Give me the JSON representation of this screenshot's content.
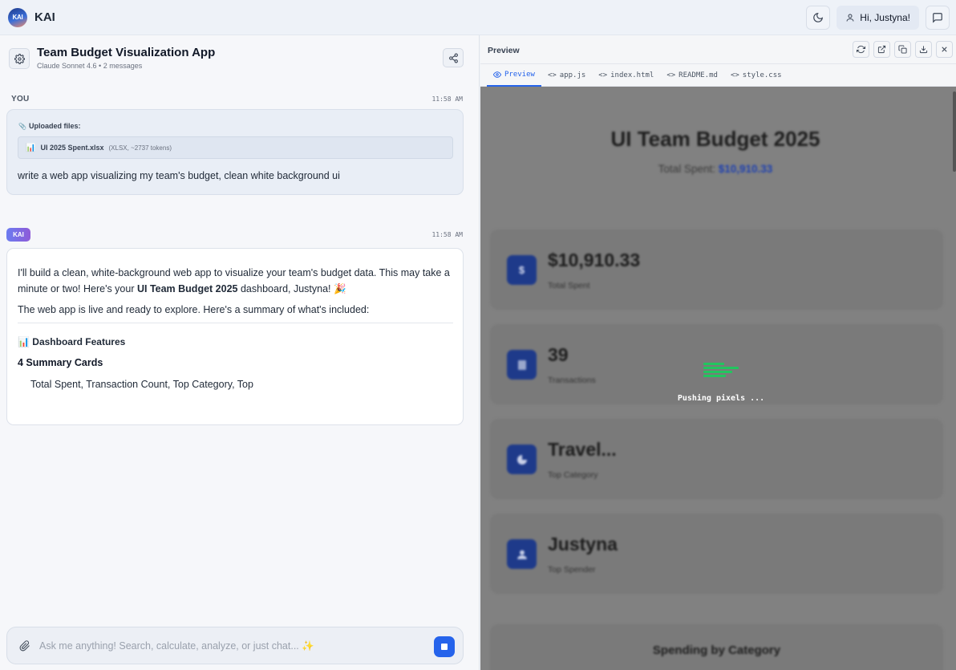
{
  "app": {
    "logo_text": "KAI",
    "brand": "KAI",
    "user_button": "Hi, Justyna!"
  },
  "chat": {
    "title": "Team Budget Visualization App",
    "subtitle": "Claude Sonnet 4.6 • 2 messages",
    "user": {
      "role": "YOU",
      "time": "11:58 AM",
      "uploaded_label": "Uploaded files:",
      "file_icon": "bar-chart-emoji",
      "file_name": "UI 2025 Spent.xlsx",
      "file_meta": "(XLSX, ~2737 tokens)",
      "message": "write a web app visualizing my team's budget, clean white background ui"
    },
    "assistant": {
      "badge": "KAI",
      "time": "11:58 AM",
      "p1_a": "I'll build a clean, white-background web app to visualize your team's budget data. This may take a minute or two! Here's your ",
      "p1_bold": "UI Team Budget 2025",
      "p1_b": " dashboard, Justyna! 🎉",
      "p2": "The web app is live and ready to explore. Here's a summary of what's included:",
      "features_heading": "📊 Dashboard Features",
      "summary_heading": "4 Summary Cards",
      "summary_items": "Total Spent, Transaction Count, Top Category, Top"
    },
    "composer": {
      "placeholder": "Ask me anything! Search, calculate, analyze, or just chat... ✨"
    }
  },
  "preview": {
    "title": "Preview",
    "tabs": [
      {
        "label": "Preview",
        "active": true
      },
      {
        "label": "app.js"
      },
      {
        "label": "index.html"
      },
      {
        "label": "README.md"
      },
      {
        "label": "style.css"
      }
    ],
    "page": {
      "heading": "UI Team Budget 2025",
      "total_label": "Total Spent: ",
      "total_value": "$10,910.33",
      "cards": [
        {
          "icon": "dollar-icon",
          "value": "$10,910.33",
          "label": "Total Spent"
        },
        {
          "icon": "receipt-icon",
          "value": "39",
          "label": "Transactions"
        },
        {
          "icon": "pie-chart-icon",
          "value": "Travel...",
          "label": "Top Category"
        },
        {
          "icon": "user-icon",
          "value": "Justyna",
          "label": "Top Spender"
        }
      ],
      "section_title": "Spending by Category"
    },
    "loader_text": "Pushing pixels ..."
  },
  "colors": {
    "accent": "#2563eb",
    "loader": "#22c55e",
    "card_icon": "#1e3a8a"
  }
}
